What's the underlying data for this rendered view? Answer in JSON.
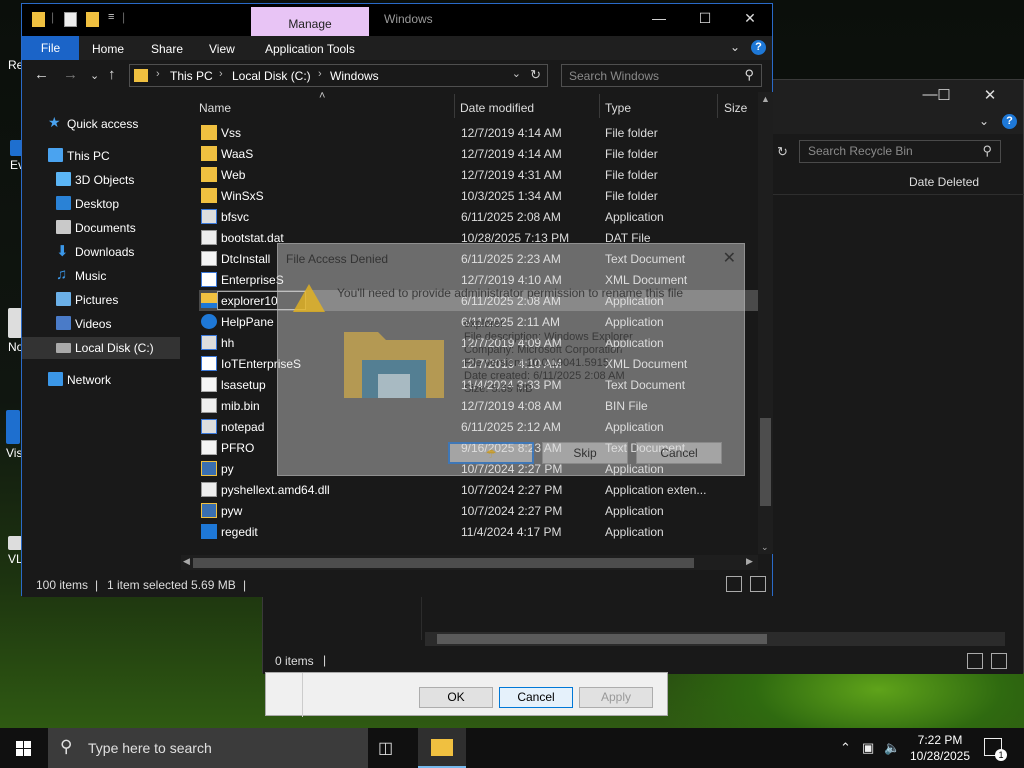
{
  "desktop": {
    "icons": [
      "Re",
      "Ev",
      "No",
      "Vis",
      "VL"
    ]
  },
  "background_window": {
    "search_placeholder": "Search Recycle Bin",
    "column_date_deleted": "Date Deleted",
    "status_items": "0 items",
    "props_dialog": {
      "ok": "OK",
      "cancel": "Cancel",
      "apply": "Apply"
    }
  },
  "window": {
    "title": "Windows",
    "manage_tab": "Manage",
    "ribbon_tabs": [
      "File",
      "Home",
      "Share",
      "View",
      "Application Tools"
    ],
    "breadcrumb": [
      "This PC",
      "Local Disk (C:)",
      "Windows"
    ],
    "search_placeholder": "Search Windows",
    "columns": {
      "name": "Name",
      "date": "Date modified",
      "type": "Type",
      "size": "Size"
    }
  },
  "nav": [
    {
      "label": "Quick access",
      "icon": "star-icon"
    },
    {
      "label": "This PC",
      "icon": "computer-icon"
    },
    {
      "label": "3D Objects",
      "icon": "cube-icon"
    },
    {
      "label": "Desktop",
      "icon": "desktop-icon"
    },
    {
      "label": "Documents",
      "icon": "documents-icon"
    },
    {
      "label": "Downloads",
      "icon": "download-icon"
    },
    {
      "label": "Music",
      "icon": "music-icon"
    },
    {
      "label": "Pictures",
      "icon": "pictures-icon"
    },
    {
      "label": "Videos",
      "icon": "videos-icon"
    },
    {
      "label": "Local Disk (C:)",
      "icon": "drive-icon"
    },
    {
      "label": "Network",
      "icon": "network-icon"
    }
  ],
  "files": [
    {
      "name": "Vss",
      "date": "12/7/2019 4:14 AM",
      "type": "File folder",
      "icon": "folder"
    },
    {
      "name": "WaaS",
      "date": "12/7/2019 4:14 AM",
      "type": "File folder",
      "icon": "folder"
    },
    {
      "name": "Web",
      "date": "12/7/2019 4:31 AM",
      "type": "File folder",
      "icon": "folder"
    },
    {
      "name": "WinSxS",
      "date": "10/3/2025 1:34 AM",
      "type": "File folder",
      "icon": "folder"
    },
    {
      "name": "bfsvc",
      "date": "6/11/2025 2:08 AM",
      "type": "Application",
      "icon": "app"
    },
    {
      "name": "bootstat.dat",
      "date": "10/28/2025 7:13 PM",
      "type": "DAT File",
      "icon": "file"
    },
    {
      "name": "DtcInstall",
      "date": "6/11/2025 2:23 AM",
      "type": "Text Document",
      "icon": "text"
    },
    {
      "name": "EnterpriseS",
      "date": "12/7/2019 4:10 AM",
      "type": "XML Document",
      "icon": "xml"
    },
    {
      "name": "explorer10",
      "date": "6/11/2025 2:08 AM",
      "type": "Application",
      "icon": "explorer"
    },
    {
      "name": "HelpPane",
      "date": "6/11/2025 2:11 AM",
      "type": "Application",
      "icon": "help"
    },
    {
      "name": "hh",
      "date": "12/7/2019 4:09 AM",
      "type": "Application",
      "icon": "app"
    },
    {
      "name": "IoTEnterpriseS",
      "date": "12/7/2019 4:10 AM",
      "type": "XML Document",
      "icon": "xml"
    },
    {
      "name": "lsasetup",
      "date": "11/4/2024 3:33 PM",
      "type": "Text Document",
      "icon": "text"
    },
    {
      "name": "mib.bin",
      "date": "12/7/2019 4:08 AM",
      "type": "BIN File",
      "icon": "file"
    },
    {
      "name": "notepad",
      "date": "6/11/2025 2:12 AM",
      "type": "Application",
      "icon": "app"
    },
    {
      "name": "PFRO",
      "date": "9/16/2025 8:23 AM",
      "type": "Text Document",
      "icon": "text"
    },
    {
      "name": "py",
      "date": "10/7/2024 2:27 PM",
      "type": "Application",
      "icon": "python"
    },
    {
      "name": "pyshellext.amd64.dll",
      "date": "10/7/2024 2:27 PM",
      "type": "Application exten...",
      "icon": "file"
    },
    {
      "name": "pyw",
      "date": "10/7/2024 2:27 PM",
      "type": "Application",
      "icon": "python"
    },
    {
      "name": "regedit",
      "date": "11/4/2024 4:17 PM",
      "type": "Application",
      "icon": "regedit"
    }
  ],
  "status": {
    "items": "100 items",
    "selected": "1 item selected  5.69 MB"
  },
  "dialog": {
    "title": "File Access Denied",
    "message": "You'll need to provide administrator permission to rename this file",
    "info_name": "explorer",
    "info_desc": "File description: Windows Explorer",
    "info_company": "Company: Microsoft Corporation",
    "info_version": "File version: 10.0.19041.5915",
    "info_date": "Date created: 6/11/2025 2:08 AM",
    "info_size": "Size: 5.69 MB",
    "skip": "Skip",
    "cancel": "Cancel"
  },
  "taskbar": {
    "search_placeholder": "Type here to search",
    "time": "7:22 PM",
    "date": "10/28/2025",
    "notif_count": "1"
  },
  "colors": {
    "accent": "#1b64c8",
    "manage": "#e8c4f5",
    "folder": "#f0c040"
  }
}
